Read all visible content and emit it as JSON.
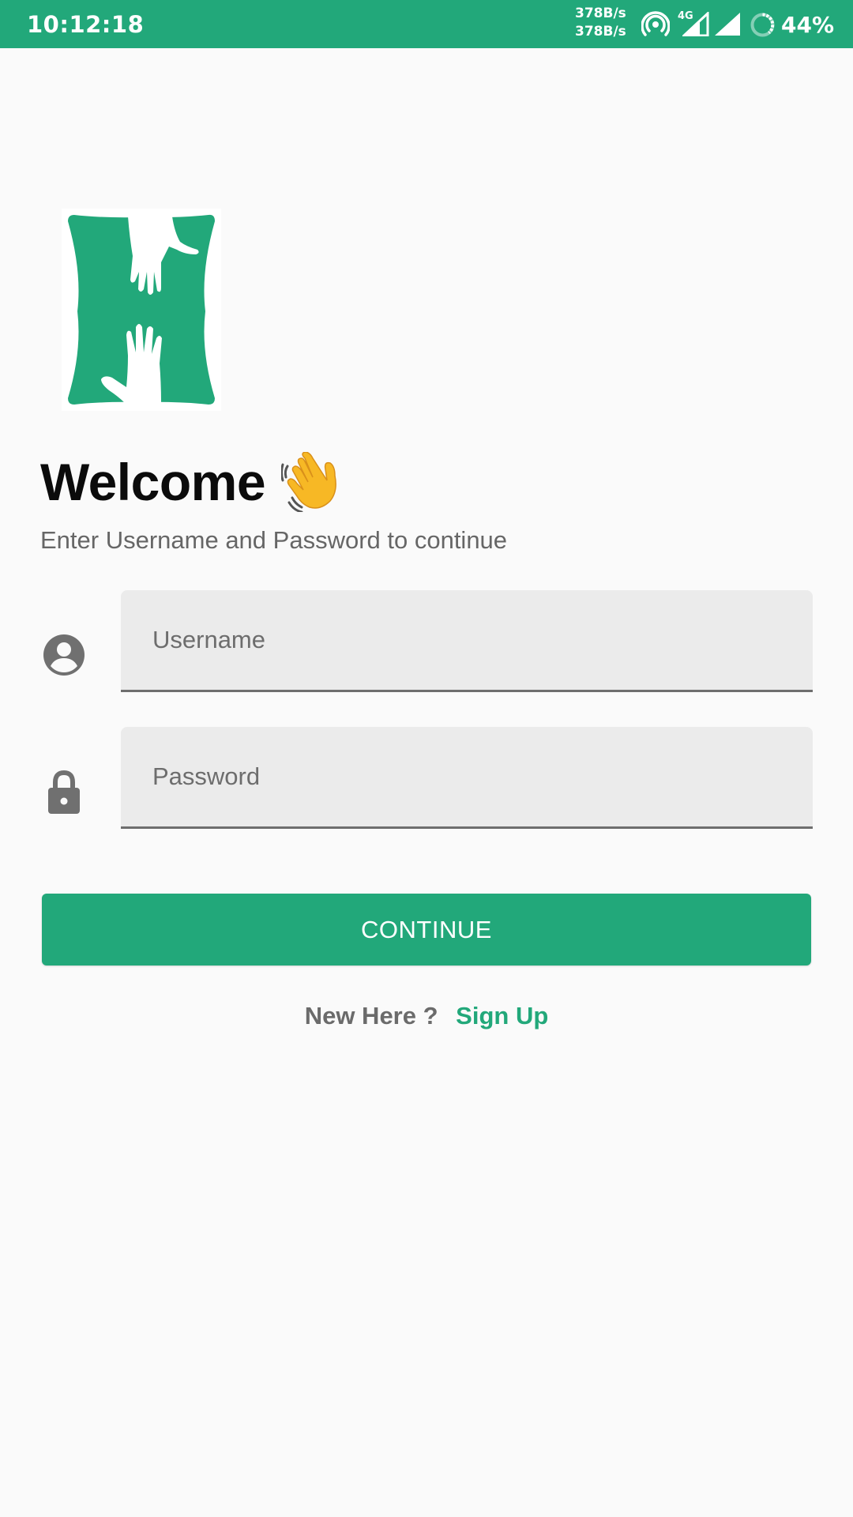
{
  "status_bar": {
    "time": "10:12:18",
    "upload_speed": "378B/s",
    "download_speed": "378B/s",
    "network_type": "4G",
    "battery_percent": "44%",
    "icons": [
      "hotspot-icon",
      "signal-4g-icon",
      "signal-icon",
      "battery-icon"
    ]
  },
  "logo": {
    "icon": "helping-hands-logo"
  },
  "header": {
    "title": "Welcome",
    "title_icon": "waving-hand-icon",
    "subtitle": "Enter Username and Password to continue"
  },
  "form": {
    "username": {
      "icon": "account-circle-icon",
      "placeholder": "Username",
      "value": ""
    },
    "password": {
      "icon": "lock-icon",
      "placeholder": "Password",
      "value": ""
    },
    "continue_label": "CONTINUE"
  },
  "footer": {
    "prompt": "New Here ?",
    "sign_up_label": "Sign Up"
  },
  "colors": {
    "primary": "#22a87a",
    "background": "#fafafa",
    "field_background": "#ebebeb",
    "secondary_text": "#666666"
  }
}
